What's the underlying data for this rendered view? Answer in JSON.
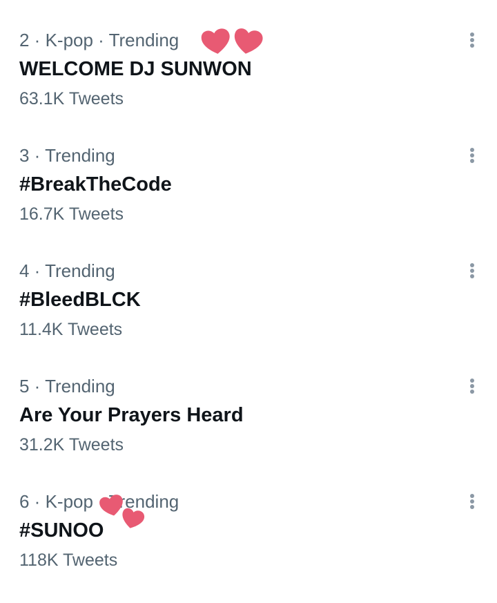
{
  "trends": [
    {
      "meta": "2 · K-pop · Trending",
      "title": "WELCOME DJ SUNWON",
      "count": "63.1K Tweets"
    },
    {
      "meta": "3 · Trending",
      "title": "#BreakTheCode",
      "count": "16.7K Tweets"
    },
    {
      "meta": "4 · Trending",
      "title": "#BleedBLCK",
      "count": "11.4K Tweets"
    },
    {
      "meta": "5 · Trending",
      "title": "Are Your Prayers Heard",
      "count": "31.2K Tweets"
    },
    {
      "meta": "6 · K-pop · Trending",
      "title": "#SUNOO",
      "count": "118K Tweets"
    }
  ],
  "icons": {
    "more": "more-vertical-icon",
    "sticker": "heart-sticker-icon"
  },
  "colors": {
    "primary_text": "#0f1419",
    "secondary_text": "#536471",
    "heart": "#e85a73"
  }
}
